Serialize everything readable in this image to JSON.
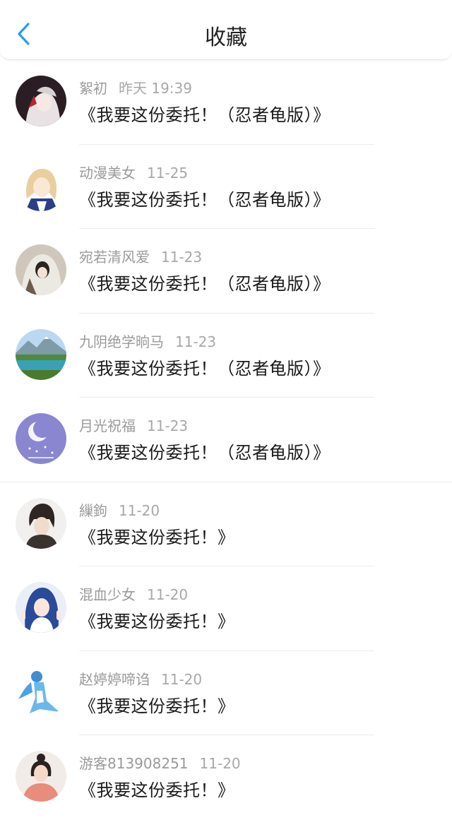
{
  "header": {
    "title": "收藏",
    "back_icon": "chevron-left-icon",
    "accent_color": "#2b9af3"
  },
  "favorites": [
    {
      "user": "絮初",
      "time": "昨天 19:39",
      "text": "《我要这份委托！（忍者龟版）》",
      "avatar_color": "#3a2a30"
    },
    {
      "user": "动漫美女",
      "time": "11-25",
      "text": "《我要这份委托！（忍者龟版）》",
      "avatar_color": "#e8d3a8"
    },
    {
      "user": "宛若清风爱",
      "time": "11-23",
      "text": "《我要这份委托！（忍者龟版）》",
      "avatar_color": "#8a7a6a"
    },
    {
      "user": "九阴绝学晌马",
      "time": "11-23",
      "text": "《我要这份委托！（忍者龟版）》",
      "avatar_color": "#3e8a4a"
    },
    {
      "user": "月光祝福",
      "time": "11-23",
      "text": "《我要这份委托！（忍者龟版）》",
      "avatar_color": "#7a78c4"
    },
    {
      "user": "繅鉤",
      "time": "11-20",
      "text": "《我要这份委托！》",
      "avatar_color": "#3a3432"
    },
    {
      "user": "混血少女",
      "time": "11-20",
      "text": "《我要这份委托！》",
      "avatar_color": "#2c4a8a"
    },
    {
      "user": "赵婷婷啼诌",
      "time": "11-20",
      "text": "《我要这份委托！》",
      "avatar_color": "#3f8fcf"
    },
    {
      "user": "游客813908251",
      "time": "11-20",
      "text": "《我要这份委托！》",
      "avatar_color": "#d89a86"
    }
  ]
}
